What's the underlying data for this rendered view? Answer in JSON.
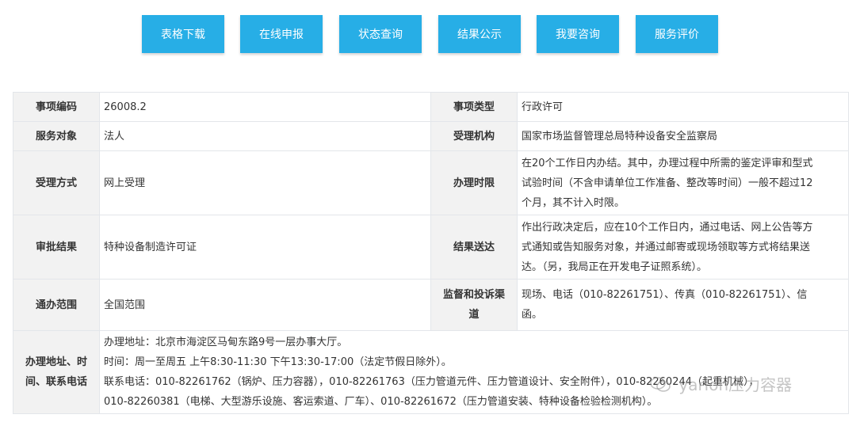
{
  "buttons": [
    {
      "label": "表格下载"
    },
    {
      "label": "在线申报"
    },
    {
      "label": "状态查询"
    },
    {
      "label": "结果公示"
    },
    {
      "label": "我要咨询"
    },
    {
      "label": "服务评价"
    }
  ],
  "table": {
    "item_code_label": "事项编码",
    "item_code": "26008.2",
    "item_type_label": "事项类型",
    "item_type": "行政许可",
    "service_target_label": "服务对象",
    "service_target": "法人",
    "agency_label": "受理机构",
    "agency": "国家市场监督管理总局特种设备安全监察局",
    "accept_method_label": "受理方式",
    "accept_method": "网上受理",
    "time_limit_label": "办理时限",
    "time_limit_lines": [
      "在20个工作日内办结。其中，办理过程中所需的鉴定评审和型式",
      "试验时间（不含申请单位工作准备、整改等时间）一般不超过12",
      "个月，其不计入时限。"
    ],
    "result_label": "审批结果",
    "result": "特种设备制造许可证",
    "delivery_label": "结果送达",
    "delivery_lines": [
      "作出行政决定后，应在10个工作日内，通过电话、网上公告等方",
      "式通知或告知服务对象，并通过邮寄或现场领取等方式将结果送",
      "达。（另，我局正在开发电子证照系统）。"
    ],
    "scope_label": "通办范围",
    "scope": "全国范围",
    "complaint_label_lines": [
      "监督和投诉渠",
      "道"
    ],
    "complaint_lines": [
      "现场、电话（010-82261751）、传真（010-82261751）、信",
      "函。"
    ],
    "contact_label_lines": [
      "办理地址、时",
      "间、联系电话"
    ],
    "contact_lines": [
      "办理地址：北京市海淀区马甸东路9号一层办事大厅。",
      "时间：周一至周五 上午8:30-11:30 下午13:30-17:00（法定节假日除外）。",
      "联系电话：010-82261762（锅炉、压力容器），010-82261763（压力管道元件、压力管道设计、安全附件），010-82260244（起重机械），",
      "010-82260381（电梯、大型游乐设施、客运索道、厂车）、010-82261672（压力管道安装、特种设备检验检测机构）。"
    ]
  },
  "watermark": {
    "text": "yarlon压力容器",
    "icon": "wechat-icon"
  }
}
